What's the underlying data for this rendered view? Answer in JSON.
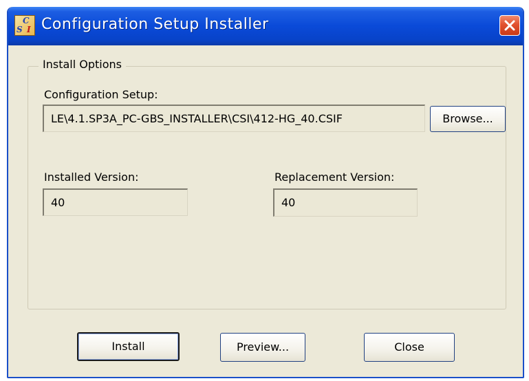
{
  "window": {
    "title": "Configuration Setup Installer",
    "app_icon_letters": {
      "top": "C",
      "left": "S",
      "right": "I"
    }
  },
  "install_options": {
    "group_label": "Install Options",
    "config_setup_label": "Configuration Setup:",
    "config_setup_value": "LE\\4.1.SP3A_PC-GBS_INSTALLER\\CSI\\412-HG_40.CSIF",
    "browse_label": "Browse...",
    "installed_version_label": "Installed Version:",
    "installed_version_value": "40",
    "replacement_version_label": "Replacement Version:",
    "replacement_version_value": "40"
  },
  "buttons": {
    "install": "Install",
    "preview": "Preview...",
    "close": "Close"
  },
  "colors": {
    "titlebar": "#0a4ad8",
    "window_bg": "#ece9d8",
    "close_button": "#e2512f"
  },
  "icons": {
    "app": "csi-app-icon",
    "close": "close-icon"
  }
}
